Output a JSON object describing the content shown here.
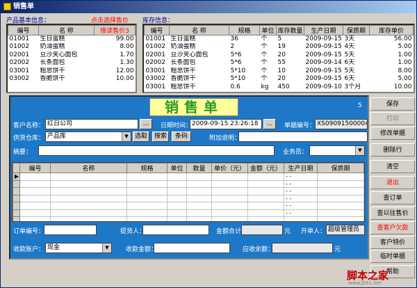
{
  "window": {
    "title": "销售单"
  },
  "product": {
    "label": "产品基本信息：",
    "hint": "点击选择售价",
    "cols": [
      "编号",
      "名  称",
      "搜读售价3"
    ],
    "rows": [
      [
        "01001",
        "生日蛋糕",
        "99.00"
      ],
      [
        "01002",
        "奶油蛋糕",
        "8.00"
      ],
      [
        "02001",
        "豆沙夹心面包",
        "1.70"
      ],
      [
        "02002",
        "长条面包",
        "1.30"
      ],
      [
        "03001",
        "粗思饼干",
        "12.00"
      ],
      [
        "03002",
        "香脆饼干",
        "10.00"
      ]
    ]
  },
  "stock": {
    "label": "库存信息：",
    "cols": [
      "编号",
      "名  称",
      "规格",
      "单位",
      "库存数量",
      "生产日期",
      "保质期",
      "库存单价"
    ],
    "rows": [
      [
        "01001",
        "生日蛋糕",
        "36",
        "个",
        "5",
        "2009-09-15",
        "3天",
        "56.00"
      ],
      [
        "01002",
        "奶油蛋糕",
        "2",
        "个",
        "19",
        "2009-09-15",
        "4天",
        "5.00"
      ],
      [
        "02001",
        "豆沙夹心面包",
        "5*6",
        "个",
        "20",
        "2009-09-15",
        "5天",
        "1.00"
      ],
      [
        "02002",
        "长条面包",
        "5*6",
        "个",
        "55",
        "2009-09-14",
        "6天",
        "1.00"
      ],
      [
        "03001",
        "粗思饼干",
        "5*10",
        "个",
        "10",
        "2009-09-15",
        "5天",
        "8.00"
      ],
      [
        "03002",
        "香脆饼干",
        "5*10",
        "个",
        "20",
        "2009-09-15",
        "6天",
        "5.00"
      ],
      [
        "03001",
        "粗思饼干",
        "0.6",
        "kg",
        "450",
        "2009-09-10",
        "3个月",
        "10.00"
      ]
    ]
  },
  "form": {
    "title": "销售单",
    "badge": "5",
    "customer_label": "客户名称：",
    "customer": "红日公司",
    "more": "...",
    "date_label": "日期时间：",
    "date": "2009-09-15 23:26:18",
    "order_label": "单据编号：",
    "order_no": "XS09091500004",
    "warehouse_label": "供货仓库：",
    "warehouse": "产品库",
    "select_btn": "选取",
    "search_btn": "搜索",
    "barcode_btn": "条码",
    "note_label": "附加说明：",
    "note": "",
    "summary_label": "摘要：",
    "summary": "",
    "salesman_label": "业务员：",
    "salesman": "",
    "detail_cols": [
      "编号",
      "名称",
      "规格",
      "单位",
      "数量",
      "单价（元）",
      "金额（元）",
      "生产日期",
      "保质期"
    ],
    "detail_rows": [
      [
        "",
        "",
        "",
        "",
        "",
        "",
        "",
        "-  -",
        ""
      ],
      [
        "",
        "",
        "",
        "",
        "",
        "",
        "",
        "-  -",
        ""
      ],
      [
        "",
        "",
        "",
        "",
        "",
        "",
        "",
        "-  -",
        ""
      ],
      [
        "",
        "",
        "",
        "",
        "",
        "",
        "",
        "-  -",
        ""
      ],
      [
        "",
        "",
        "",
        "",
        "",
        "",
        "",
        "-  -",
        ""
      ],
      [
        "",
        "",
        "",
        "",
        "",
        "",
        "",
        "-  -",
        ""
      ],
      [
        "",
        "",
        "",
        "",
        "",
        "",
        "",
        "",
        ""
      ]
    ],
    "order_no2_label": "订单编号：",
    "order_no2": "",
    "picker_label": "提货人：",
    "picker": "",
    "total_label": "金额合计：",
    "total": "",
    "yuan": "元",
    "maker_label": "开单人：",
    "maker": "超级管理员",
    "account_label": "收款账户：",
    "account": "现金",
    "received_label": "收款金额：",
    "received": "",
    "receivable_label": "应收余额：",
    "receivable": ""
  },
  "side": [
    "保存",
    "打印",
    "修改单据",
    "删除行",
    "清空",
    "退出",
    "查订单",
    "查以往售价",
    "查客户欠款",
    "客户特价",
    "临时单据",
    "帮助"
  ],
  "watermark": {
    "text": "脚本之家",
    "url": "www.jb51.net"
  }
}
